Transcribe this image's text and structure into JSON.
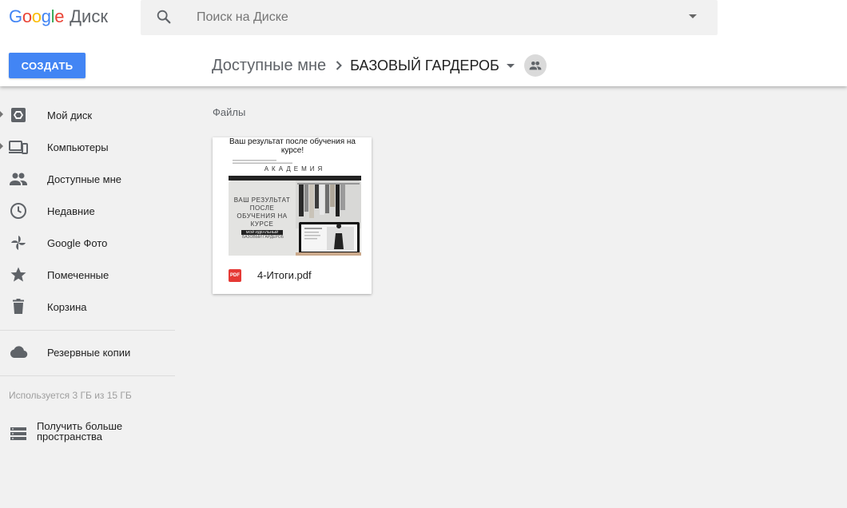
{
  "app": {
    "logo_letters": [
      {
        "ch": "G",
        "color": "#4285F4"
      },
      {
        "ch": "o",
        "color": "#EA4335"
      },
      {
        "ch": "o",
        "color": "#FBBC05"
      },
      {
        "ch": "g",
        "color": "#4285F4"
      },
      {
        "ch": "l",
        "color": "#34A853"
      },
      {
        "ch": "e",
        "color": "#EA4335"
      }
    ],
    "product": "Диск"
  },
  "search": {
    "placeholder": "Поиск на Диске",
    "value": ""
  },
  "toolbar": {
    "create_label": "СОЗДАТЬ",
    "accent_color": "#4285F4"
  },
  "breadcrumb": {
    "parent": "Доступные мне",
    "current": "БАЗОВЫЙ ГАРДЕРОБ"
  },
  "sidebar": {
    "items": [
      {
        "label": "Мой диск",
        "icon": "drive-icon",
        "expandable": true
      },
      {
        "label": "Компьютеры",
        "icon": "computers-icon",
        "expandable": true
      },
      {
        "label": "Доступные мне",
        "icon": "people-icon",
        "expandable": false
      },
      {
        "label": "Недавние",
        "icon": "clock-icon",
        "expandable": false
      },
      {
        "label": "Google Фото",
        "icon": "pinwheel-icon",
        "expandable": false
      },
      {
        "label": "Помеченные",
        "icon": "star-icon",
        "expandable": false
      },
      {
        "label": "Корзина",
        "icon": "trash-icon",
        "expandable": false
      }
    ],
    "backups": {
      "label": "Резервные копии",
      "icon": "cloud-icon"
    },
    "storage_text": "Используется 3 ГБ из 15 ГБ",
    "more_space_label": "Получить больше пространства"
  },
  "main": {
    "section_title": "Файлы",
    "files": [
      {
        "name": "4-Итоги.pdf",
        "type_badge": "PDF",
        "thumbnail": {
          "heading": "Ваш результат после обучения на курсе!",
          "brand": "АКАДЕМИЯ",
          "title": "ВАШ РЕЗУЛЬТАТ ПОСЛЕ ОБУЧЕНИЯ НА КУРСЕ",
          "bar_label": "МОЙ ИДЕАЛЬНЫЙ",
          "subtitle": "БАЗОВЫЙ ГАРДЕРОБ"
        }
      }
    ]
  }
}
